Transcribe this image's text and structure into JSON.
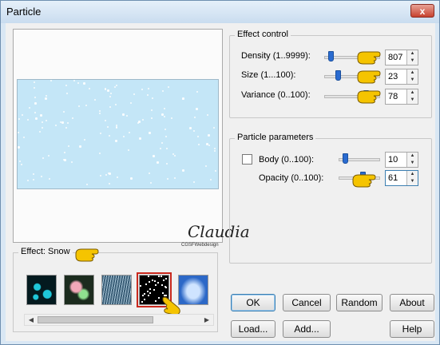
{
  "window": {
    "title": "Particle",
    "close_glyph": "x"
  },
  "effect_control": {
    "title": "Effect control",
    "density": {
      "label": "Density (1..9999):",
      "value": "807",
      "slider_fraction": 0.08
    },
    "size": {
      "label": "Size (1...100):",
      "value": "23",
      "slider_fraction": 0.23
    },
    "variance": {
      "label": "Variance (0..100):",
      "value": "78",
      "slider_fraction": 0.78
    }
  },
  "particle_parameters": {
    "title": "Particle parameters",
    "body": {
      "label": "Body (0..100):",
      "value": "10",
      "checked": false,
      "slider_fraction": 0.1
    },
    "opacity": {
      "label": "Opacity (0..100):",
      "value": "61",
      "slider_fraction": 0.61
    }
  },
  "effects": {
    "title": "Effect: Snow",
    "thumbnails": [
      {
        "name": "bubbles",
        "colors": [
          "#041a1f",
          "#1fc7d9"
        ]
      },
      {
        "name": "bokeh",
        "colors": [
          "#1b2b1e",
          "#f2a8b8"
        ]
      },
      {
        "name": "rain",
        "colors": [
          "#3b5f78",
          "#a8c4d6"
        ]
      },
      {
        "name": "snow",
        "colors": [
          "#000000",
          "#ffffff"
        ],
        "selected": true
      },
      {
        "name": "clouds",
        "colors": [
          "#2c68c7",
          "#cfe4ff"
        ]
      }
    ]
  },
  "watermark": {
    "text": "Claudia",
    "subtext": "CGSFWebdesign"
  },
  "buttons": {
    "ok": "OK",
    "cancel": "Cancel",
    "random": "Random",
    "about": "About",
    "load": "Load...",
    "add": "Add...",
    "help": "Help"
  },
  "colors": {
    "accent": "#2a6bd0",
    "hand": "#f5c400",
    "selected_border": "#c8281d",
    "preview": "#c4e6f7"
  }
}
